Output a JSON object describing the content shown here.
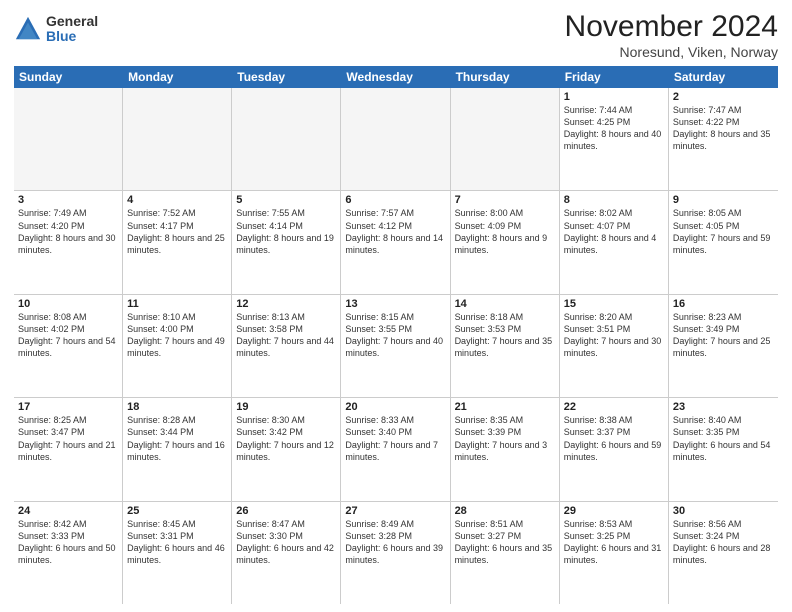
{
  "logo": {
    "general": "General",
    "blue": "Blue"
  },
  "title": "November 2024",
  "location": "Noresund, Viken, Norway",
  "headers": [
    "Sunday",
    "Monday",
    "Tuesday",
    "Wednesday",
    "Thursday",
    "Friday",
    "Saturday"
  ],
  "weeks": [
    [
      {
        "day": "",
        "info": ""
      },
      {
        "day": "",
        "info": ""
      },
      {
        "day": "",
        "info": ""
      },
      {
        "day": "",
        "info": ""
      },
      {
        "day": "",
        "info": ""
      },
      {
        "day": "1",
        "info": "Sunrise: 7:44 AM\nSunset: 4:25 PM\nDaylight: 8 hours and 40 minutes."
      },
      {
        "day": "2",
        "info": "Sunrise: 7:47 AM\nSunset: 4:22 PM\nDaylight: 8 hours and 35 minutes."
      }
    ],
    [
      {
        "day": "3",
        "info": "Sunrise: 7:49 AM\nSunset: 4:20 PM\nDaylight: 8 hours and 30 minutes."
      },
      {
        "day": "4",
        "info": "Sunrise: 7:52 AM\nSunset: 4:17 PM\nDaylight: 8 hours and 25 minutes."
      },
      {
        "day": "5",
        "info": "Sunrise: 7:55 AM\nSunset: 4:14 PM\nDaylight: 8 hours and 19 minutes."
      },
      {
        "day": "6",
        "info": "Sunrise: 7:57 AM\nSunset: 4:12 PM\nDaylight: 8 hours and 14 minutes."
      },
      {
        "day": "7",
        "info": "Sunrise: 8:00 AM\nSunset: 4:09 PM\nDaylight: 8 hours and 9 minutes."
      },
      {
        "day": "8",
        "info": "Sunrise: 8:02 AM\nSunset: 4:07 PM\nDaylight: 8 hours and 4 minutes."
      },
      {
        "day": "9",
        "info": "Sunrise: 8:05 AM\nSunset: 4:05 PM\nDaylight: 7 hours and 59 minutes."
      }
    ],
    [
      {
        "day": "10",
        "info": "Sunrise: 8:08 AM\nSunset: 4:02 PM\nDaylight: 7 hours and 54 minutes."
      },
      {
        "day": "11",
        "info": "Sunrise: 8:10 AM\nSunset: 4:00 PM\nDaylight: 7 hours and 49 minutes."
      },
      {
        "day": "12",
        "info": "Sunrise: 8:13 AM\nSunset: 3:58 PM\nDaylight: 7 hours and 44 minutes."
      },
      {
        "day": "13",
        "info": "Sunrise: 8:15 AM\nSunset: 3:55 PM\nDaylight: 7 hours and 40 minutes."
      },
      {
        "day": "14",
        "info": "Sunrise: 8:18 AM\nSunset: 3:53 PM\nDaylight: 7 hours and 35 minutes."
      },
      {
        "day": "15",
        "info": "Sunrise: 8:20 AM\nSunset: 3:51 PM\nDaylight: 7 hours and 30 minutes."
      },
      {
        "day": "16",
        "info": "Sunrise: 8:23 AM\nSunset: 3:49 PM\nDaylight: 7 hours and 25 minutes."
      }
    ],
    [
      {
        "day": "17",
        "info": "Sunrise: 8:25 AM\nSunset: 3:47 PM\nDaylight: 7 hours and 21 minutes."
      },
      {
        "day": "18",
        "info": "Sunrise: 8:28 AM\nSunset: 3:44 PM\nDaylight: 7 hours and 16 minutes."
      },
      {
        "day": "19",
        "info": "Sunrise: 8:30 AM\nSunset: 3:42 PM\nDaylight: 7 hours and 12 minutes."
      },
      {
        "day": "20",
        "info": "Sunrise: 8:33 AM\nSunset: 3:40 PM\nDaylight: 7 hours and 7 minutes."
      },
      {
        "day": "21",
        "info": "Sunrise: 8:35 AM\nSunset: 3:39 PM\nDaylight: 7 hours and 3 minutes."
      },
      {
        "day": "22",
        "info": "Sunrise: 8:38 AM\nSunset: 3:37 PM\nDaylight: 6 hours and 59 minutes."
      },
      {
        "day": "23",
        "info": "Sunrise: 8:40 AM\nSunset: 3:35 PM\nDaylight: 6 hours and 54 minutes."
      }
    ],
    [
      {
        "day": "24",
        "info": "Sunrise: 8:42 AM\nSunset: 3:33 PM\nDaylight: 6 hours and 50 minutes."
      },
      {
        "day": "25",
        "info": "Sunrise: 8:45 AM\nSunset: 3:31 PM\nDaylight: 6 hours and 46 minutes."
      },
      {
        "day": "26",
        "info": "Sunrise: 8:47 AM\nSunset: 3:30 PM\nDaylight: 6 hours and 42 minutes."
      },
      {
        "day": "27",
        "info": "Sunrise: 8:49 AM\nSunset: 3:28 PM\nDaylight: 6 hours and 39 minutes."
      },
      {
        "day": "28",
        "info": "Sunrise: 8:51 AM\nSunset: 3:27 PM\nDaylight: 6 hours and 35 minutes."
      },
      {
        "day": "29",
        "info": "Sunrise: 8:53 AM\nSunset: 3:25 PM\nDaylight: 6 hours and 31 minutes."
      },
      {
        "day": "30",
        "info": "Sunrise: 8:56 AM\nSunset: 3:24 PM\nDaylight: 6 hours and 28 minutes."
      }
    ]
  ],
  "colors": {
    "header_bg": "#2a6db5",
    "header_text": "#ffffff",
    "empty_bg": "#f0f0f0",
    "cell_bg": "#ffffff",
    "border": "#cccccc"
  }
}
